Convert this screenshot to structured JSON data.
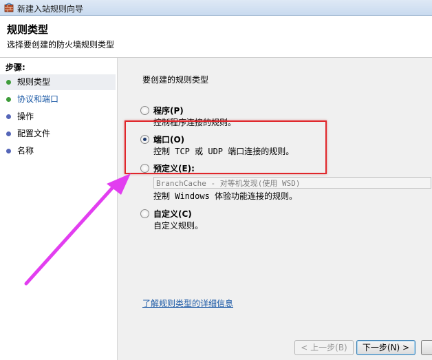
{
  "window": {
    "title": "新建入站规则向导"
  },
  "header": {
    "title": "规则类型",
    "subtitle": "选择要创建的防火墙规则类型"
  },
  "steps": {
    "heading": "步骤:",
    "items": [
      {
        "label": "规则类型",
        "dot_color": "#3e9c3a"
      },
      {
        "label": "协议和端口",
        "dot_color": "#3e9c3a"
      },
      {
        "label": "操作",
        "dot_color": "#5566b8"
      },
      {
        "label": "配置文件",
        "dot_color": "#5566b8"
      },
      {
        "label": "名称",
        "dot_color": "#5566b8"
      }
    ]
  },
  "main": {
    "prompt": "要创建的规则类型",
    "options": [
      {
        "label": "程序(P)",
        "description": "控制程序连接的规则。",
        "checked": false
      },
      {
        "label": "端口(O)",
        "description": "控制 TCP 或 UDP 端口连接的规则。",
        "checked": true
      },
      {
        "label": "预定义(E):",
        "description": "控制 Windows 体验功能连接的规则。",
        "checked": false
      },
      {
        "label": "自定义(C)",
        "description": "自定义规则。",
        "checked": false
      }
    ],
    "predefined_select": "BranchCache - 对等机发现(使用 WSD)",
    "learn_more_link": "了解规则类型的详细信息"
  },
  "buttons": {
    "back": "< 上一步(B)",
    "next": "下一步(N) >"
  },
  "colors": {
    "annotation_box": "#e0262b",
    "annotation_arrow": "#e23ef0"
  }
}
